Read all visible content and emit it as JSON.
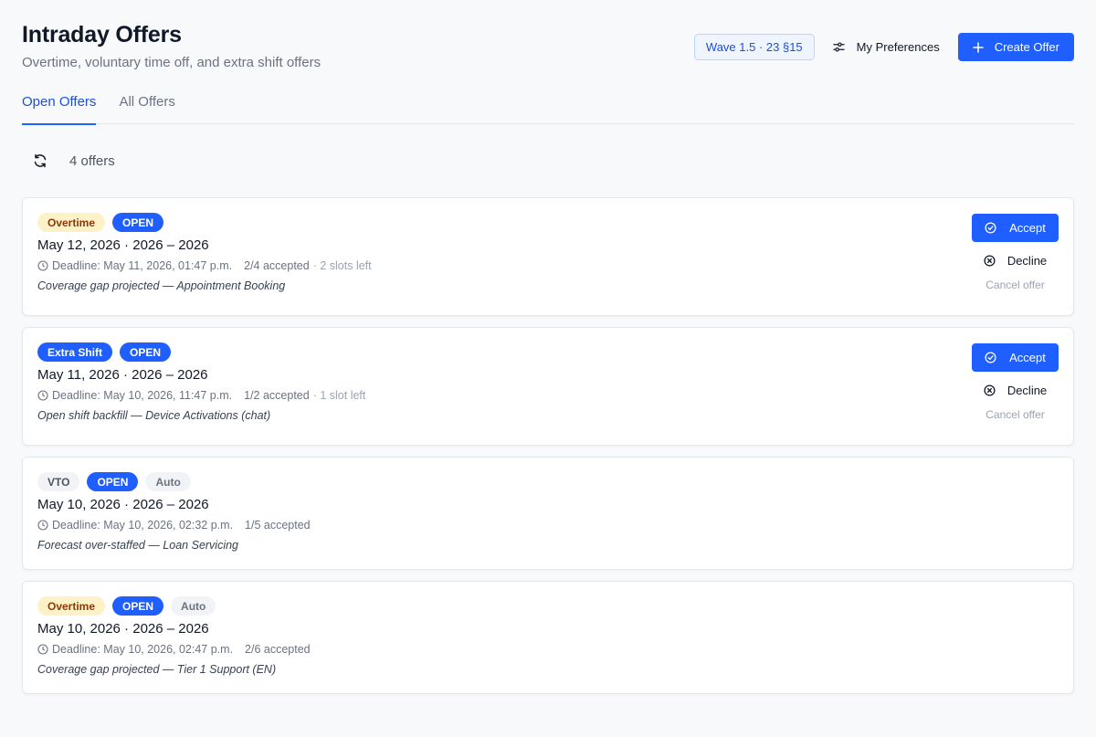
{
  "header": {
    "title": "Intraday Offers",
    "subtitle": "Overtime, voluntary time off, and extra shift offers",
    "wave_badge": "Wave 1.5 · 23 §15",
    "preferences_label": "My Preferences",
    "create_label": "Create Offer"
  },
  "tabs": [
    {
      "label": "Open Offers",
      "active": true
    },
    {
      "label": "All Offers",
      "active": false
    }
  ],
  "toolbar": {
    "count_text": "4 offers"
  },
  "offers": [
    {
      "type": "Overtime",
      "status": "OPEN",
      "title": "May 12, 2026 · 2026 – 2026",
      "deadline": "Deadline: May 11, 2026, 01:47 p.m.",
      "accepted": "2/4 accepted",
      "slots": "· 2 slots left",
      "note": "Coverage gap projected — Appointment Booking",
      "accept_label": "Accept",
      "decline_label": "Decline",
      "cancel_label": "Cancel offer"
    },
    {
      "type": "Extra Shift",
      "status": "OPEN",
      "title": "May 11, 2026 · 2026 – 2026",
      "deadline": "Deadline: May 10, 2026, 11:47 p.m.",
      "accepted": "1/2 accepted",
      "slots": "· 1 slot left",
      "note": "Open shift backfill — Device Activations (chat)",
      "accept_label": "Accept",
      "decline_label": "Decline",
      "cancel_label": "Cancel offer"
    },
    {
      "type": "VTO",
      "status": "OPEN",
      "auto": "Auto",
      "title": "May 10, 2026 · 2026 – 2026",
      "deadline": "Deadline: May 10, 2026, 02:32 p.m.",
      "accepted": "1/5 accepted",
      "note": "Forecast over-staffed — Loan Servicing"
    },
    {
      "type": "Overtime",
      "status": "OPEN",
      "auto": "Auto",
      "title": "May 10, 2026 · 2026 – 2026",
      "deadline": "Deadline: May 10, 2026, 02:47 p.m.",
      "accepted": "2/6 accepted",
      "note": "Coverage gap projected — Tier 1 Support (EN)"
    }
  ],
  "colors": {
    "accent": "#1f5eff",
    "overtime_bg": "#fdf1c7",
    "overtime_text": "#8a3b0b",
    "neutral_badge_bg": "#f1f3f6"
  }
}
